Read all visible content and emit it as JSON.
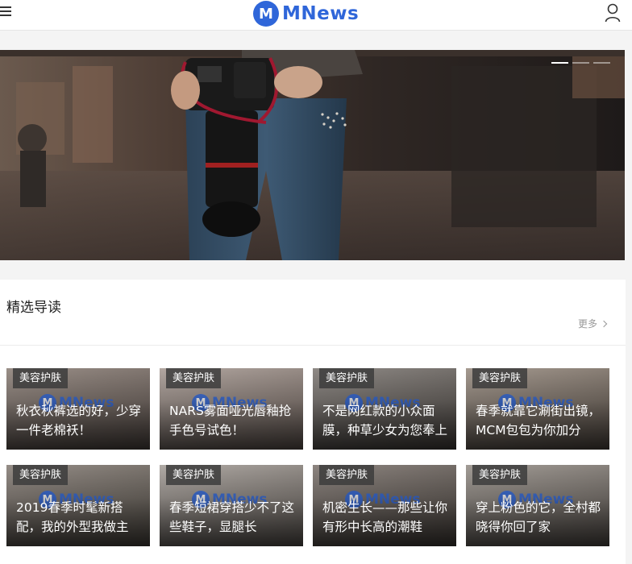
{
  "header": {
    "menu_icon": "hamburger-menu-icon",
    "logo_badge": "M",
    "logo_text": "MNews",
    "user_icon": "user-icon",
    "brand_color": "#2f66d9"
  },
  "banner": {
    "slides_total": 3,
    "active_slide": 1
  },
  "section": {
    "title": "精选导读",
    "more_label": "更多"
  },
  "watermark": {
    "badge": "M",
    "text": "MNews"
  },
  "cards": [
    {
      "tag": "美容护肤",
      "title": "秋衣秋裤选的好，少穿一件老棉袄！"
    },
    {
      "tag": "美容护肤",
      "title": "NARS雾面哑光唇釉抢手色号试色！"
    },
    {
      "tag": "美容护肤",
      "title": "不是网红款的小众面膜，种草少女为您奉上"
    },
    {
      "tag": "美容护肤",
      "title": "春季就靠它涮街出镜，MCM包包为你加分"
    },
    {
      "tag": "美容护肤",
      "title": "2019春季时髦新搭配，我的外型我做主"
    },
    {
      "tag": "美容护肤",
      "title": "春季短裙穿搭少不了这些鞋子，显腿长"
    },
    {
      "tag": "美容护肤",
      "title": "机密生长——那些让你有形中长高的潮鞋"
    },
    {
      "tag": "美容护肤",
      "title": "穿上粉色的它，全村都晓得你回了家"
    }
  ]
}
